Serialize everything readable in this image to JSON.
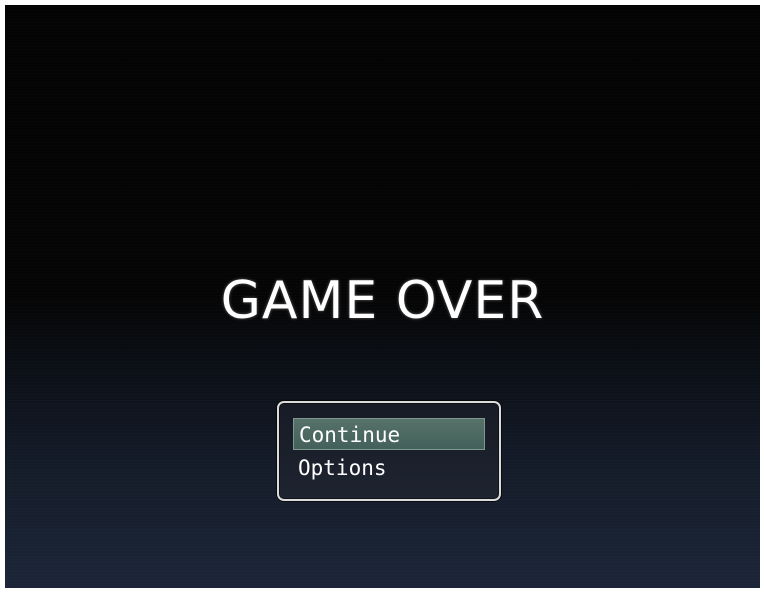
{
  "title": "GAME OVER",
  "menu": {
    "items": [
      {
        "label": "Continue",
        "selected": true
      },
      {
        "label": "Options",
        "selected": false
      }
    ]
  },
  "colors": {
    "background_top": "#040404",
    "background_bottom": "#1c2638",
    "selection": "#4e6a62",
    "window_border": "#dcdcdc",
    "text": "#ffffff"
  }
}
